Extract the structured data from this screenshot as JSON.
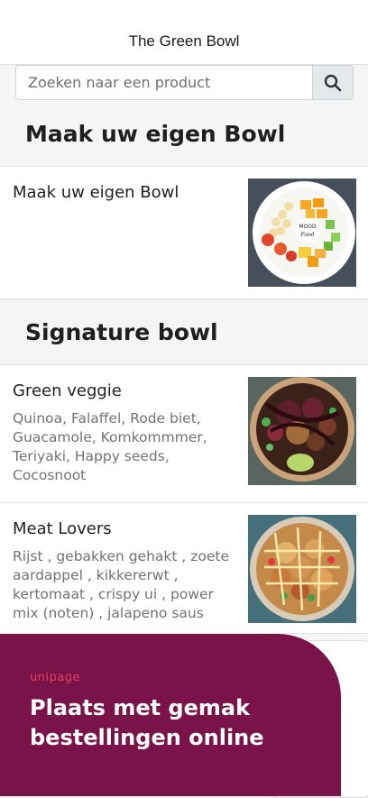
{
  "header": {
    "title": "The Green Bowl"
  },
  "search": {
    "placeholder": "Zoeken naar een product",
    "icon": "search-icon"
  },
  "sections": [
    {
      "title": "Maak uw eigen Bowl",
      "products": [
        {
          "name": "Maak uw eigen Bowl",
          "description": ""
        }
      ]
    },
    {
      "title": "Signature bowl",
      "products": [
        {
          "name": "Green veggie",
          "description": "Quinoa, Falaffel, Rode biet, Guacamole, Komkommmer, Teriyaki, Happy seeds, Cocosnoot"
        },
        {
          "name": "Meat Lovers",
          "description": "Rijst , gebakken gehakt , zoete aardappel , kikkererwt , kertomaat , crispy ui , power mix (noten) , jalapeno saus"
        }
      ]
    }
  ],
  "promo": {
    "brand": "unipage",
    "text": "Plaats met gemak bestellingen online"
  },
  "colors": {
    "promo_background": "#7a1349",
    "brand_accent": "#e0415d",
    "page_background": "#f4f5f5"
  }
}
